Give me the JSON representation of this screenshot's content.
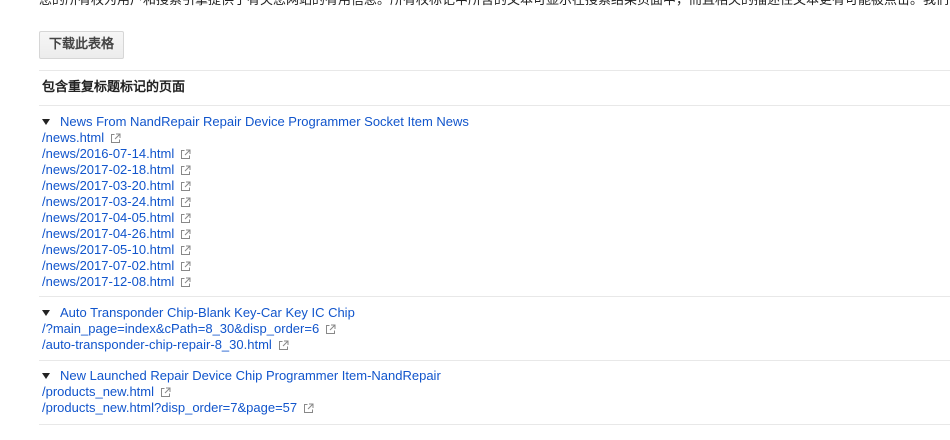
{
  "top_text": "您的所有权为用户和搜索引擎提供了有关您网站的有用信息。所有权标记中所含的文本可显示在搜索结果页面中，而且相关的描述性文本更有可能被点击。我们",
  "download_button": "下载此表格",
  "section_title": "包含重复标题标记的页面",
  "groups": [
    {
      "title": "News From NandRepair Repair Device Programmer Socket Item News",
      "links": [
        "/news.html",
        "/news/2016-07-14.html",
        "/news/2017-02-18.html",
        "/news/2017-03-20.html",
        "/news/2017-03-24.html",
        "/news/2017-04-05.html",
        "/news/2017-04-26.html",
        "/news/2017-05-10.html",
        "/news/2017-07-02.html",
        "/news/2017-12-08.html"
      ]
    },
    {
      "title": "Auto Transponder Chip-Blank Key-Car Key IC Chip",
      "links": [
        "/?main_page=index&cPath=8_30&disp_order=6",
        "/auto-transponder-chip-repair-8_30.html"
      ]
    },
    {
      "title": "New Launched Repair Device Chip Programmer Item-NandRepair",
      "links": [
        "/products_new.html",
        "/products_new.html?disp_order=7&page=57"
      ]
    }
  ],
  "colors": {
    "link": "#1155cc",
    "text": "#222222",
    "divider": "#e8e8e8",
    "icon": "#888888"
  }
}
